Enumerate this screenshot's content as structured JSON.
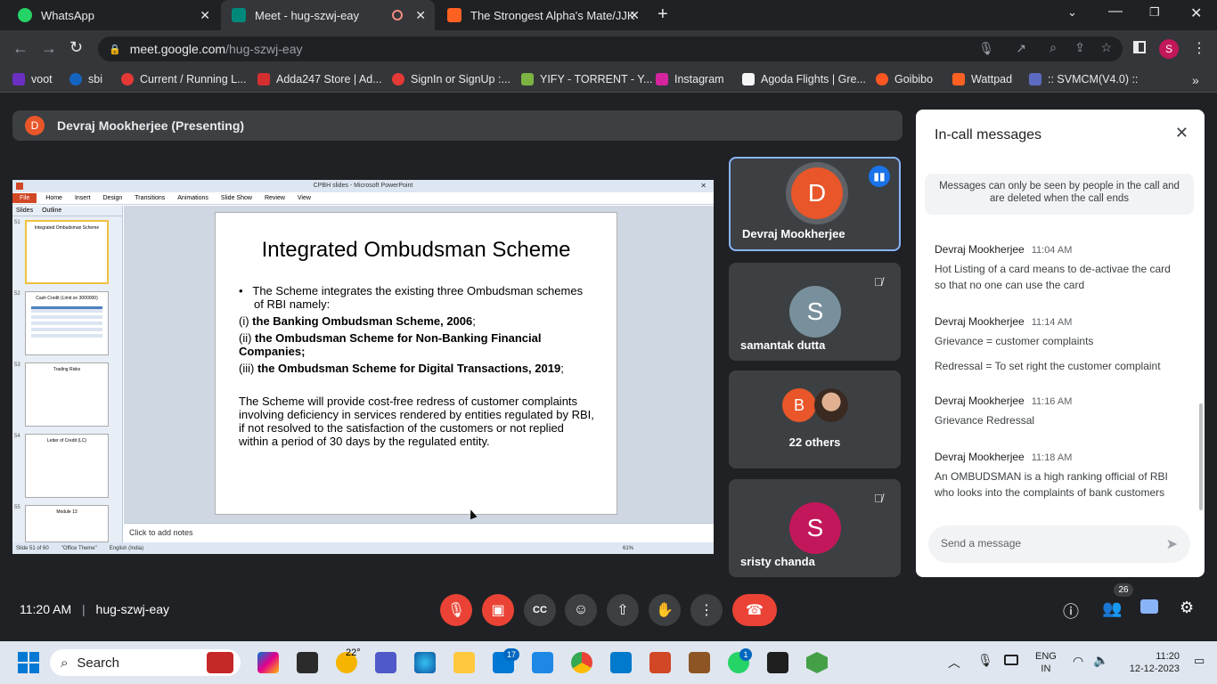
{
  "tabs": [
    {
      "title": "WhatsApp",
      "icon": "whatsapp-icon",
      "color": "#25d366"
    },
    {
      "title": "Meet - hug-szwj-eay",
      "icon": "meet-icon",
      "color": "#00897b"
    },
    {
      "title": "The Strongest Alpha's Mate/JJK",
      "icon": "wattpad-icon",
      "color": "#ff6122"
    }
  ],
  "address": {
    "domain": "meet.google.com",
    "path": "/hug-szwj-eay"
  },
  "profile_initial": "S",
  "bookmarks": [
    "voot",
    "sbi",
    "Current / Running L...",
    "Adda247 Store | Ad...",
    "SignIn or SignUp :...",
    "YIFY - TORRENT - Y...",
    "Instagram",
    "Agoda Flights | Gre...",
    "Goibibo",
    "Wattpad",
    ":: SVMCM(V4.0) ::"
  ],
  "presenter": {
    "initial": "D",
    "label": "Devraj Mookherjee (Presenting)"
  },
  "ppt": {
    "window_title": "CPBH slides  -  Microsoft PowerPoint",
    "ribbon": [
      "File",
      "Home",
      "Insert",
      "Design",
      "Transitions",
      "Animations",
      "Slide Show",
      "Review",
      "View"
    ],
    "pane_tabs": [
      "Slides",
      "Outline"
    ],
    "thumbs": [
      {
        "num": "51",
        "title": "Integrated Ombudsman Scheme"
      },
      {
        "num": "52",
        "title": "Cash Credit (Limit on 3000000)"
      },
      {
        "num": "53",
        "title": "Trading Risks"
      },
      {
        "num": "54",
        "title": "Letter of Credit (LC)"
      },
      {
        "num": "55",
        "title": "Module 13"
      }
    ],
    "slide": {
      "title": "Integrated Ombudsman Scheme",
      "bullet": "The Scheme integrates the existing three Ombudsman schemes of RBI namely:",
      "items": [
        {
          "prefix": "(i) ",
          "bold": "the Banking Ombudsman Scheme, 2006",
          "suffix": ";"
        },
        {
          "prefix": "(ii) ",
          "bold": "the Ombudsman Scheme for Non-Banking Financial Companies;",
          "suffix": ""
        },
        {
          "prefix": "(iii) ",
          "bold": "the Ombudsman Scheme for Digital Transactions, 2019",
          "suffix": ";"
        }
      ],
      "para": "The Scheme will provide cost-free redress of customer complaints involving deficiency in services rendered by entities regulated by RBI, if not resolved to the satisfaction of the customers or not replied within a period of 30 days by the regulated entity."
    },
    "notes": "Click to add notes",
    "status": {
      "slide": "Slide 51 of 60",
      "theme": "\"Office Theme\"",
      "lang": "English (India)",
      "zoom": "61%"
    }
  },
  "tiles": [
    {
      "initial": "D",
      "name": "Devraj Mookherjee",
      "color": "#e8562a"
    },
    {
      "initial": "S",
      "name": "samantak dutta",
      "color": "#78909c"
    },
    {
      "initial": "B",
      "name": "22 others",
      "color": "#e8562a"
    },
    {
      "initial": "S",
      "name": "sristy chanda",
      "color": "#c2185b"
    }
  ],
  "chat": {
    "title": "In-call messages",
    "notice": "Messages can only be seen by people in the call and are deleted when the call ends",
    "messages": [
      {
        "sender": "Devraj Mookherjee",
        "time": "11:04 AM",
        "texts": [
          "Hot Listing of a card means to de-activae the card so that no one can use the card"
        ]
      },
      {
        "sender": "Devraj Mookherjee",
        "time": "11:14 AM",
        "texts": [
          "Grievance = customer complaints",
          "Redressal = To set right the customer complaint"
        ]
      },
      {
        "sender": "Devraj Mookherjee",
        "time": "11:16 AM",
        "texts": [
          "Grievance Redressal"
        ]
      },
      {
        "sender": "Devraj Mookherjee",
        "time": "11:18 AM",
        "texts": [
          "An OMBUDSMAN is a high ranking official of RBI who looks into the complaints of bank customers"
        ]
      }
    ],
    "placeholder": "Send a message"
  },
  "controls": {
    "time": "11:20 AM",
    "code": "hug-szwj-eay",
    "people_count": "26"
  },
  "taskbar": {
    "search": "Search",
    "weather": "22°",
    "mail_badge": "17",
    "whatsapp_badge": "1",
    "lang1": "ENG",
    "lang2": "IN",
    "clock": "11:20",
    "date": "12-12-2023"
  }
}
